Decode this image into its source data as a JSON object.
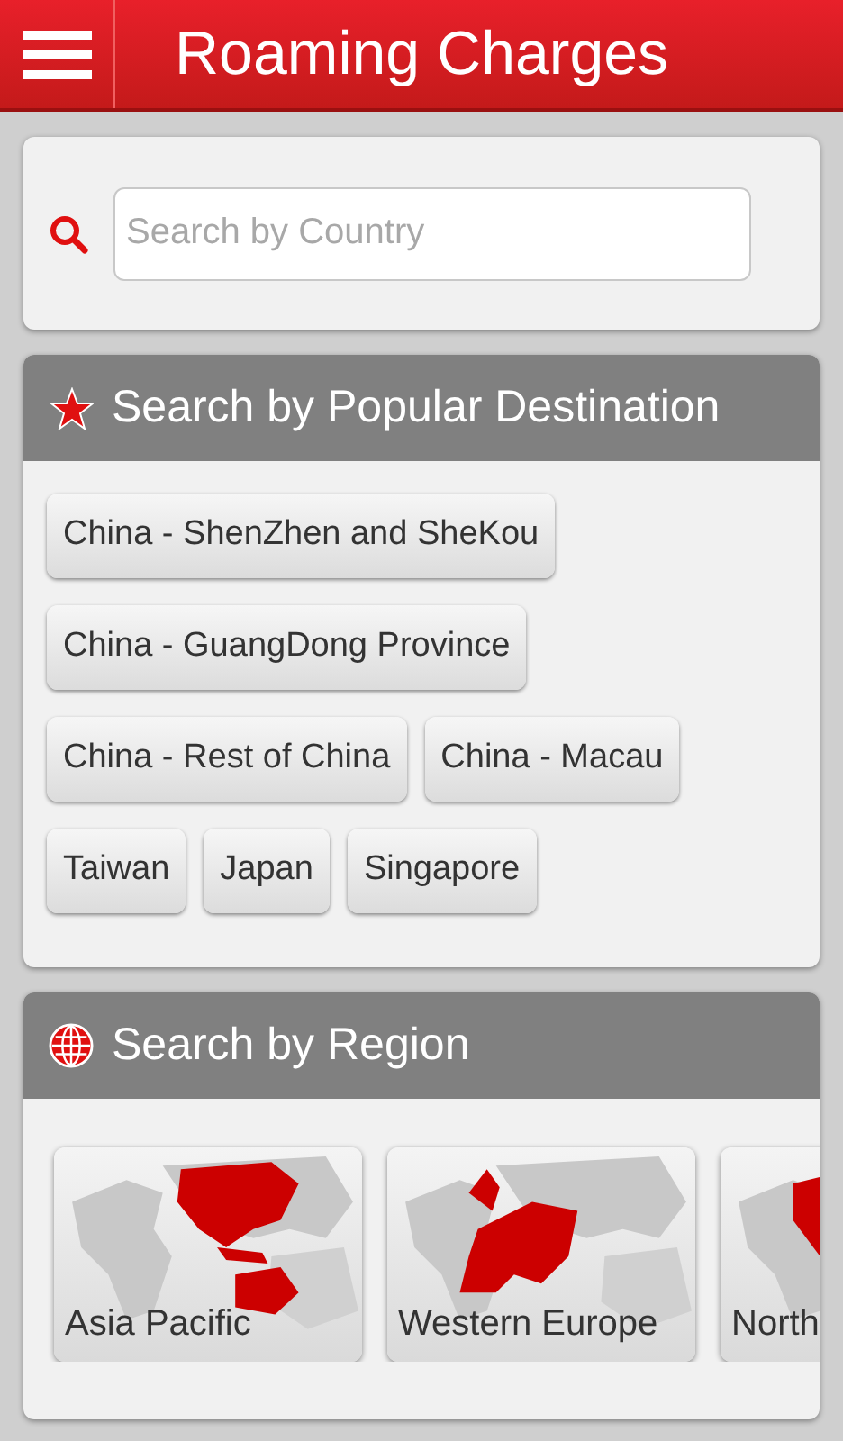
{
  "header": {
    "title": "Roaming Charges"
  },
  "search": {
    "placeholder": "Search by Country"
  },
  "popular": {
    "title": "Search by Popular Destination",
    "destinations": [
      "China - ShenZhen and SheKou",
      "China - GuangDong Province",
      "China - Rest of China",
      "China - Macau",
      "Taiwan",
      "Japan",
      "Singapore"
    ]
  },
  "regions": {
    "title": "Search by Region",
    "items": [
      {
        "label": "Asia Pacific",
        "kind": "asia"
      },
      {
        "label": "Western Europe",
        "kind": "europe"
      },
      {
        "label": "North",
        "kind": "america"
      }
    ]
  }
}
